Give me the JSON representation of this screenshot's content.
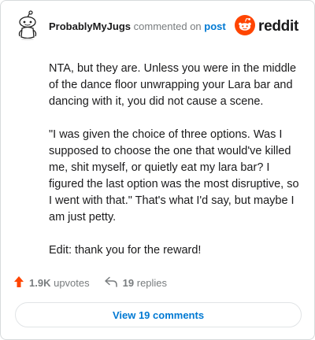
{
  "header": {
    "username": "ProbablyMyJugs",
    "action_text": "commented on",
    "post_link": "post",
    "logo_text": "reddit"
  },
  "comment": {
    "paragraphs": [
      "NTA, but they are. Unless you were in the middle of the dance floor unwrapping your Lara bar and dancing with it, you did not cause a scene.",
      "\"I was given the choice of three options. Was I supposed to choose the one that would've killed me, shit myself, or quietly eat my lara bar? I figured the last option was the most disruptive, so I went with that.\" That's what I'd say, but maybe I am just petty.",
      "Edit: thank you for the reward!"
    ]
  },
  "actions": {
    "upvotes_count": "1.9K",
    "upvotes_label": "upvotes",
    "replies_count": "19",
    "replies_label": "replies"
  },
  "footer": {
    "view_comments_label": "View 19 comments"
  },
  "colors": {
    "brand": "#ff4500",
    "link": "#0079d3",
    "muted": "#787c7e"
  },
  "icons": {
    "avatar": "snoo-avatar-icon",
    "logo": "reddit-alien-icon",
    "upvote": "upvote-arrow-icon",
    "reply": "reply-arrow-icon"
  }
}
